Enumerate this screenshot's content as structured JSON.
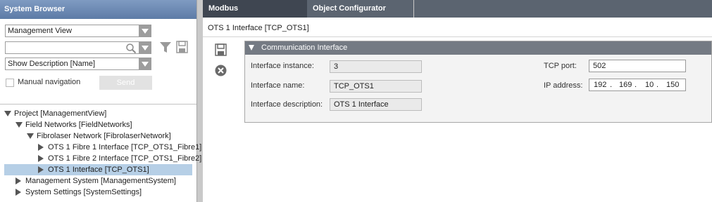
{
  "system_browser": {
    "title": "System Browser",
    "view_select": "Management View",
    "search_value": "",
    "description_select": "Show Description [Name]",
    "manual_navigation_label": "Manual navigation",
    "send_label": "Send"
  },
  "tree": [
    {
      "label": "Project [ManagementView]",
      "level": 0,
      "expanded": true,
      "selected": false
    },
    {
      "label": "Field Networks [FieldNetworks]",
      "level": 1,
      "expanded": true,
      "selected": false
    },
    {
      "label": "Fibrolaser Network [FibrolaserNetwork]",
      "level": 2,
      "expanded": true,
      "selected": false
    },
    {
      "label": "OTS 1 Fibre 1 Interface [TCP_OTS1_Fibre1]",
      "level": 3,
      "expanded": false,
      "selected": false
    },
    {
      "label": "OTS 1 Fibre 2 Interface [TCP_OTS1_Fibre2]",
      "level": 3,
      "expanded": false,
      "selected": false
    },
    {
      "label": "OTS 1 Interface [TCP_OTS1]",
      "level": 3,
      "expanded": false,
      "selected": true
    },
    {
      "label": "Management System [ManagementSystem]",
      "level": 1,
      "expanded": false,
      "selected": false
    },
    {
      "label": "System Settings [SystemSettings]",
      "level": 1,
      "expanded": false,
      "selected": false
    }
  ],
  "tabs": [
    "Modbus",
    "Object Configurator"
  ],
  "object_title": "OTS 1 Interface [TCP_OTS1]",
  "group": {
    "title": "Communication Interface",
    "interface_instance_label": "Interface instance:",
    "interface_instance": "3",
    "interface_name_label": "Interface name:",
    "interface_name": "TCP_OTS1",
    "interface_description_label": "Interface description:",
    "interface_description": "OTS 1 Interface",
    "tcp_port_label": "TCP port:",
    "tcp_port": "502",
    "ip_address_label": "IP address:",
    "ip_octets": [
      "192",
      "169",
      "10",
      "150"
    ],
    "ip_dot": "."
  },
  "icons": {
    "filter": "filter-icon",
    "save_small": "save-icon",
    "search": "search-icon",
    "save": "save-icon",
    "cancel": "cancel-icon"
  },
  "colors": {
    "left_title_bg": "#6e8bb4",
    "tab_active": "#3f4651",
    "tab_inactive": "#5b6470",
    "group_header": "#747a83",
    "selection": "#b6cfe6"
  }
}
